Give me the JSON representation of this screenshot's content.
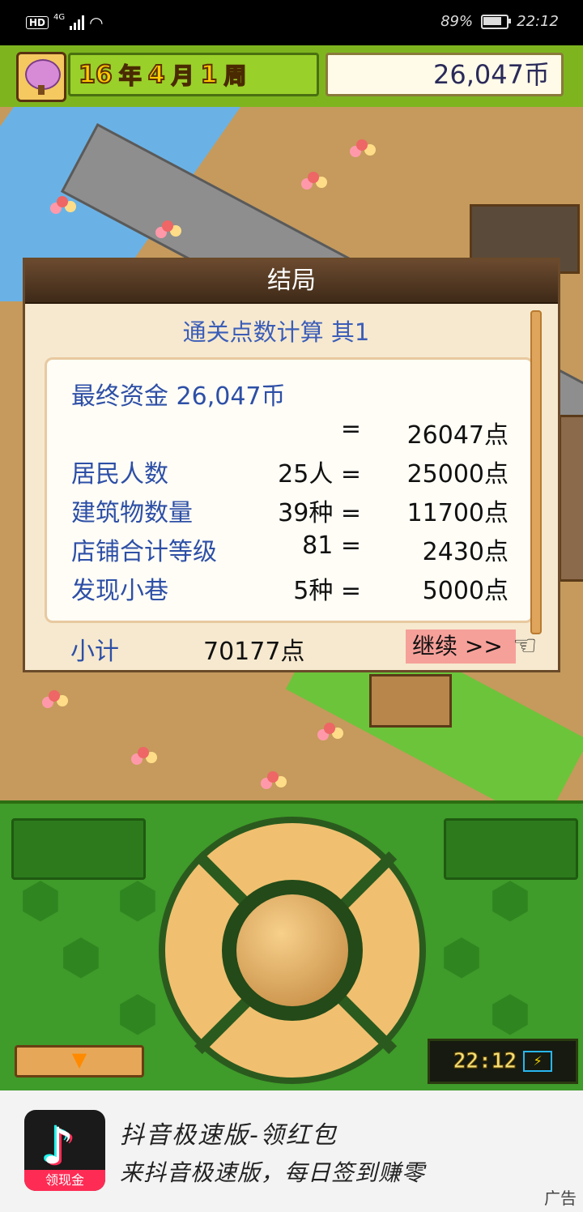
{
  "status_bar": {
    "hd": "HD",
    "network": "4G",
    "battery": "89%",
    "time": "22:12"
  },
  "game_header": {
    "year": "16",
    "year_unit": "年",
    "month": "4",
    "month_unit": "月",
    "week": "1",
    "week_unit": "周",
    "money": "26,047币"
  },
  "dialog": {
    "title": "结局",
    "subtitle": "通关点数计算 其1",
    "rows": [
      {
        "label": "最终资金 26,047币",
        "qty": "",
        "pts": ""
      },
      {
        "label": "",
        "qty": "=",
        "pts": "26047点"
      },
      {
        "label": "居民人数",
        "qty": "25人 =",
        "pts": "25000点"
      },
      {
        "label": "建筑物数量",
        "qty": "39种 =",
        "pts": "11700点"
      },
      {
        "label": "店铺合计等级",
        "qty": "81 =",
        "pts": "2430点"
      },
      {
        "label": "发现小巷",
        "qty": "5种 =",
        "pts": "5000点"
      }
    ],
    "subtotal_label": "小计",
    "subtotal_value": "70177点",
    "continue_label": "继续 >>"
  },
  "controls": {
    "clock": "22:12"
  },
  "ad": {
    "app_badge": "领现金",
    "title": "抖音极速版-领红包",
    "description": "来抖音极速版，每日签到赚零",
    "ad_tag": "广告"
  }
}
